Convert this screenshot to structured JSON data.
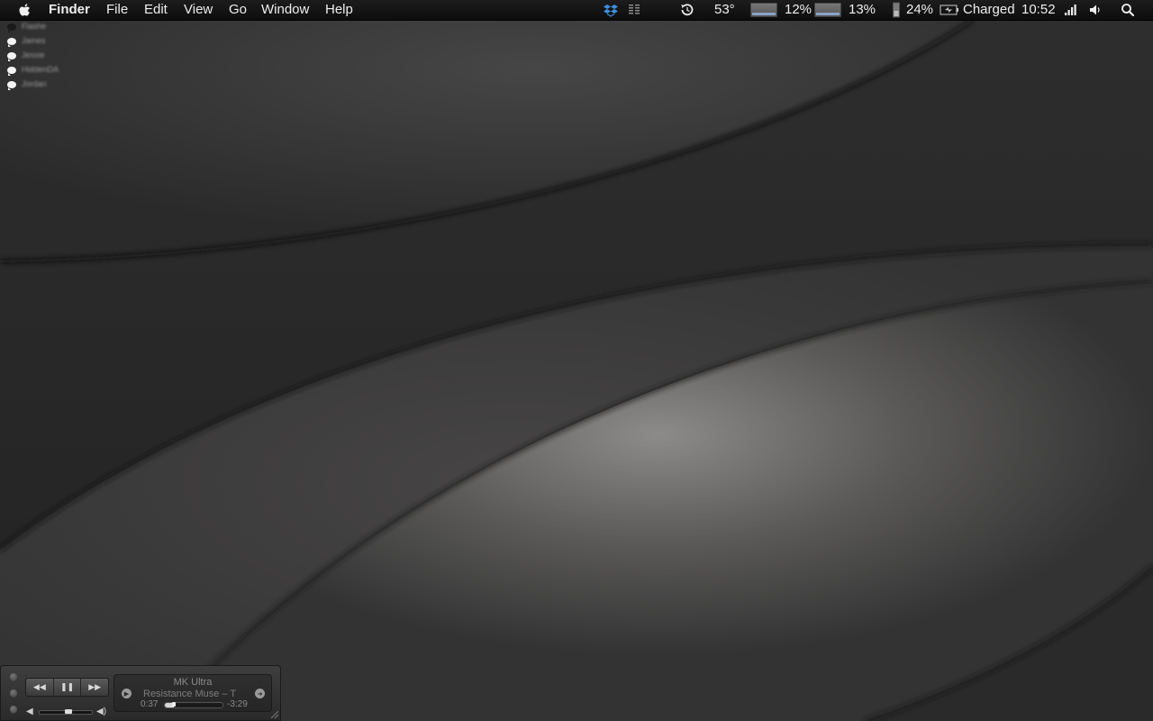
{
  "menubar": {
    "app_name": "Finder",
    "menus": [
      "File",
      "Edit",
      "View",
      "Go",
      "Window",
      "Help"
    ],
    "status": {
      "temperature": "53°",
      "cpu_percent": "12%",
      "memory_percent": "13%",
      "disk_percent": "24%",
      "battery_status": "Charged",
      "clock": "10:52"
    },
    "icons": [
      "apple-icon",
      "dropbox-icon",
      "menu-list-icon",
      "time-machine-icon",
      "battery-icon",
      "wifi-icon",
      "volume-icon",
      "spotlight-icon"
    ]
  },
  "buddies": [
    "Flashe",
    "James",
    "Jessie",
    "HiddenDA",
    "Jordan"
  ],
  "player": {
    "track_title": "MK Ultra",
    "track_sub": "Resistance    Muse – T",
    "elapsed": "0:37",
    "remaining": "-3:29",
    "progress_fraction": 0.16,
    "volume_fraction": 0.55,
    "buttons": [
      "rewind",
      "pause",
      "fast-forward"
    ]
  },
  "colors": {
    "menubar_bg": "#111111",
    "wallpaper_dark": "#222222",
    "wallpaper_light": "#8a8886"
  }
}
